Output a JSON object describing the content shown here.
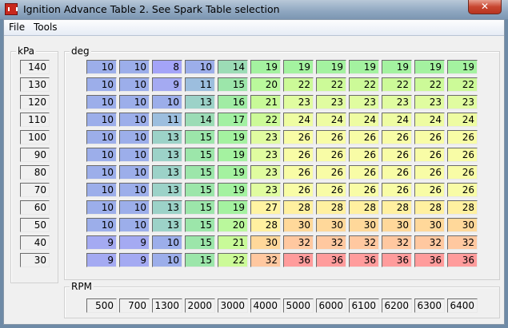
{
  "window": {
    "title": "Ignition Advance Table 2. See Spark Table selection",
    "close": "✕"
  },
  "menu": [
    "File",
    "Tools"
  ],
  "kpa": {
    "label": "kPa",
    "values": [
      "140",
      "130",
      "120",
      "110",
      "100",
      "90",
      "80",
      "70",
      "60",
      "50",
      "40",
      "30"
    ]
  },
  "deg": {
    "label": "deg",
    "rows": [
      [
        10,
        10,
        8,
        10,
        14,
        19,
        19,
        19,
        19,
        19,
        19,
        19
      ],
      [
        10,
        10,
        9,
        11,
        15,
        20,
        22,
        22,
        22,
        22,
        22,
        22
      ],
      [
        10,
        10,
        10,
        13,
        16,
        21,
        23,
        23,
        23,
        23,
        23,
        23
      ],
      [
        10,
        10,
        11,
        14,
        17,
        22,
        24,
        24,
        24,
        24,
        24,
        24
      ],
      [
        10,
        10,
        13,
        15,
        19,
        23,
        26,
        26,
        26,
        26,
        26,
        26
      ],
      [
        10,
        10,
        13,
        15,
        19,
        23,
        26,
        26,
        26,
        26,
        26,
        26
      ],
      [
        10,
        10,
        13,
        15,
        19,
        23,
        26,
        26,
        26,
        26,
        26,
        26
      ],
      [
        10,
        10,
        13,
        15,
        19,
        23,
        26,
        26,
        26,
        26,
        26,
        26
      ],
      [
        10,
        10,
        13,
        15,
        19,
        27,
        28,
        28,
        28,
        28,
        28,
        28
      ],
      [
        10,
        10,
        13,
        15,
        20,
        28,
        30,
        30,
        30,
        30,
        30,
        30
      ],
      [
        9,
        9,
        10,
        15,
        21,
        30,
        32,
        32,
        32,
        32,
        32,
        32
      ],
      [
        9,
        9,
        10,
        15,
        22,
        32,
        36,
        36,
        36,
        36,
        36,
        36
      ]
    ]
  },
  "rpm": {
    "label": "RPM",
    "values": [
      "500",
      "700",
      "1300",
      "2000",
      "3000",
      "4000",
      "5000",
      "6000",
      "6100",
      "6200",
      "6300",
      "6400"
    ]
  },
  "colors": {
    "8": "#a4a4f8",
    "9": "#a4aaf2",
    "10": "#9caeea",
    "11": "#9cbede",
    "13": "#9cd2c8",
    "14": "#9cdcb6",
    "15": "#9ce6aa",
    "16": "#a0eca4",
    "17": "#a2f0a2",
    "19": "#a4f2a0",
    "20": "#baf89c",
    "21": "#c8fa98",
    "22": "#ccfa98",
    "23": "#e0fca0",
    "24": "#eefca2",
    "26": "#f8fca6",
    "27": "#fff4a2",
    "28": "#fff0a0",
    "30": "#ffd89a",
    "32": "#ffc8a0",
    "36": "#ff9c9c"
  }
}
